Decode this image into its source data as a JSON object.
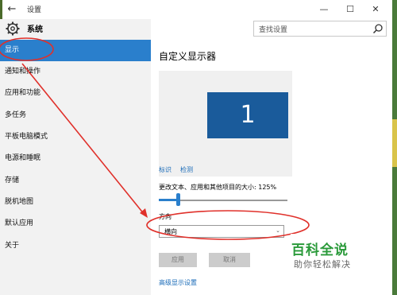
{
  "window": {
    "title": "设置",
    "back_glyph": "←",
    "minimize_glyph": "—",
    "maximize_glyph": "☐",
    "close_glyph": "✕"
  },
  "sidebar": {
    "app_title": "系统",
    "items": [
      {
        "label": "显示",
        "active": true
      },
      {
        "label": "通知和操作"
      },
      {
        "label": "应用和功能"
      },
      {
        "label": "多任务"
      },
      {
        "label": "平板电脑模式"
      },
      {
        "label": "电源和睡眠"
      },
      {
        "label": "存储"
      },
      {
        "label": "脱机地图"
      },
      {
        "label": "默认应用"
      },
      {
        "label": "关于"
      }
    ]
  },
  "search": {
    "placeholder": "查找设置"
  },
  "main": {
    "heading": "自定义显示器",
    "monitor_number": "1",
    "identify_link": "标识",
    "detect_link": "检测",
    "scale_label": "更改文本、应用和其他项目的大小: 125%",
    "scale_level_percent": 125,
    "orientation_label": "方向",
    "orientation_value": "横向",
    "apply_button": "应用",
    "cancel_button": "取消",
    "advanced_link": "高级显示设置"
  },
  "watermark": {
    "title": "百科全说",
    "subtitle": "助你轻松解决"
  },
  "colors": {
    "accent": "#2a7fcc",
    "monitor": "#1a5b9b",
    "annotation": "#e0302a",
    "watermark_green": "#2a9a3a"
  }
}
